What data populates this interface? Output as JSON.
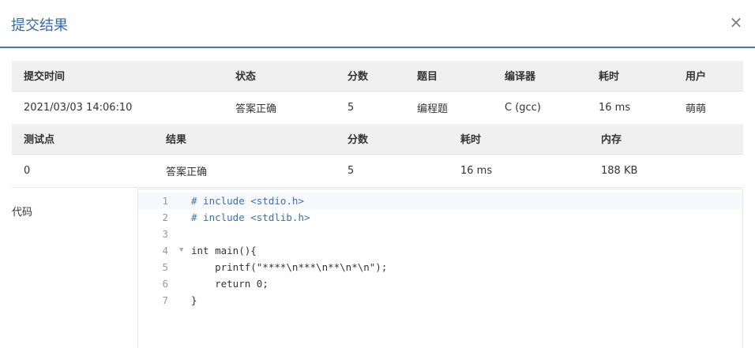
{
  "dialog": {
    "title": "提交结果",
    "close_label": "×"
  },
  "summary_table": {
    "headers": [
      "提交时间",
      "状态",
      "分数",
      "题目",
      "编译器",
      "耗时",
      "用户"
    ],
    "row": [
      "2021/03/03 14:06:10",
      "答案正确",
      "5",
      "编程题",
      "C (gcc)",
      "16 ms",
      "萌萌"
    ]
  },
  "testcase_table": {
    "headers": [
      "测试点",
      "结果",
      "分数",
      "耗时",
      "内存"
    ],
    "row": [
      "0",
      "答案正确",
      "5",
      "16 ms",
      "188 KB"
    ]
  },
  "code_section": {
    "label": "代码",
    "lines": [
      {
        "n": "1",
        "text": "# include <stdio.h>"
      },
      {
        "n": "2",
        "text": "# include <stdlib.h>"
      },
      {
        "n": "3",
        "text": ""
      },
      {
        "n": "4",
        "text": "int main(){"
      },
      {
        "n": "5",
        "text": "    printf(\"****\\n***\\n**\\n*\\n\");"
      },
      {
        "n": "6",
        "text": "    return 0;"
      },
      {
        "n": "7",
        "text": "}"
      }
    ]
  }
}
